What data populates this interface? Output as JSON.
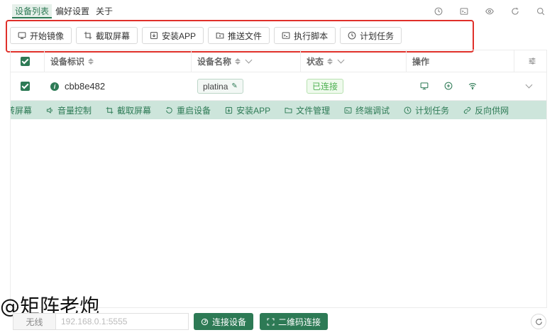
{
  "menu": {
    "items": [
      {
        "label": "设备列表",
        "active": true
      },
      {
        "label": "偏好设置",
        "active": false
      },
      {
        "label": "关于",
        "active": false
      }
    ]
  },
  "top_icons": [
    "clock-icon",
    "terminal-icon",
    "eye-icon",
    "refresh-icon",
    "search-icon"
  ],
  "toolbar": {
    "buttons": [
      {
        "label": "开始镜像",
        "icon": "monitor-icon"
      },
      {
        "label": "截取屏幕",
        "icon": "crop-icon"
      },
      {
        "label": "安装APP",
        "icon": "install-icon"
      },
      {
        "label": "推送文件",
        "icon": "folder-icon"
      },
      {
        "label": "执行脚本",
        "icon": "terminal-icon"
      },
      {
        "label": "计划任务",
        "icon": "clock-icon"
      }
    ]
  },
  "table": {
    "headers": {
      "device_id": "设备标识",
      "device_name": "设备名称",
      "status": "状态",
      "actions": "操作"
    },
    "rows": [
      {
        "selected": true,
        "device_id": "cbb8e482",
        "device_name": "platina",
        "status": "已连接"
      }
    ]
  },
  "quickbar": {
    "items": [
      {
        "label": "转屏幕",
        "icon": "rotate-icon"
      },
      {
        "label": "音量控制",
        "icon": "volume-icon"
      },
      {
        "label": "截取屏幕",
        "icon": "crop-icon"
      },
      {
        "label": "重启设备",
        "icon": "restart-icon"
      },
      {
        "label": "安装APP",
        "icon": "install-icon"
      },
      {
        "label": "文件管理",
        "icon": "folder-icon"
      },
      {
        "label": "终端调试",
        "icon": "terminal-icon"
      },
      {
        "label": "计划任务",
        "icon": "clock-icon"
      },
      {
        "label": "反向供网",
        "icon": "link-icon"
      }
    ]
  },
  "footer": {
    "mode_label": "无线",
    "address_placeholder": "192.168.0.1:5555",
    "connect_label": "连接设备",
    "qr_label": "二维码连接"
  },
  "watermark": "@矩阵老炮",
  "colors": {
    "primary": "#2d7a55",
    "quickbar_bg": "#cde5db",
    "highlight": "#e0302a",
    "status_green": "#4caf50"
  }
}
